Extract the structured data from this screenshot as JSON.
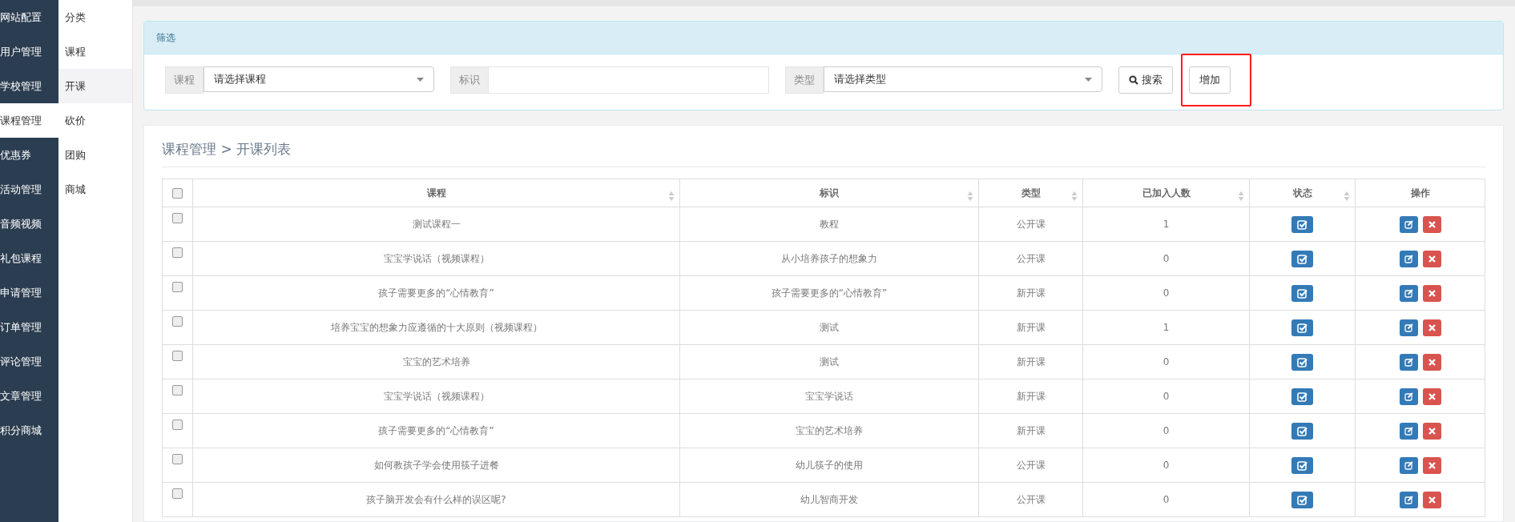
{
  "sidebar": {
    "items": [
      {
        "label": "网站配置",
        "selected": false
      },
      {
        "label": "用户管理",
        "selected": false
      },
      {
        "label": "学校管理",
        "selected": false
      },
      {
        "label": "课程管理",
        "selected": true
      },
      {
        "label": "优惠券",
        "selected": false
      },
      {
        "label": "活动管理",
        "selected": false
      },
      {
        "label": "音频视频",
        "selected": false
      },
      {
        "label": "礼包课程",
        "selected": false
      },
      {
        "label": "申请管理",
        "selected": false
      },
      {
        "label": "订单管理",
        "selected": false
      },
      {
        "label": "评论管理",
        "selected": false
      },
      {
        "label": "文章管理",
        "selected": false
      },
      {
        "label": "积分商城",
        "selected": false
      }
    ]
  },
  "submenu": {
    "items": [
      {
        "label": "分类",
        "selected": false
      },
      {
        "label": "课程",
        "selected": false
      },
      {
        "label": "开课",
        "selected": true
      },
      {
        "label": "砍价",
        "selected": false
      },
      {
        "label": "团购",
        "selected": false
      },
      {
        "label": "商城",
        "selected": false
      }
    ]
  },
  "filter": {
    "title": "筛选",
    "course": {
      "label": "课程",
      "value": "请选择课程"
    },
    "tag": {
      "label": "标识"
    },
    "type": {
      "label": "类型",
      "value": "请选择类型"
    },
    "search_button": "搜索",
    "add_button": {
      "label": "增加",
      "highlighted": true
    }
  },
  "list": {
    "breadcrumb": "课程管理 > 开课列表",
    "all_checked": false,
    "columns": [
      {
        "kind": "checkbox"
      },
      {
        "label": "课程",
        "kind": "text",
        "sortable": true
      },
      {
        "label": "标识",
        "kind": "text",
        "sortable": true
      },
      {
        "label": "类型",
        "kind": "text",
        "sortable": true
      },
      {
        "label": "已加入人数",
        "kind": "text",
        "sortable": true
      },
      {
        "label": "状态",
        "kind": "text",
        "sortable": true
      },
      {
        "label": "操作",
        "kind": "text",
        "sortable": false
      }
    ],
    "rows": [
      {
        "checked": false,
        "course": "测试课程一",
        "tag": "教程",
        "type": "公开课",
        "joined": "1"
      },
      {
        "checked": false,
        "course": "宝宝学说话（视频课程）",
        "tag": "从小培养孩子的想象力",
        "type": "公开课",
        "joined": "0"
      },
      {
        "checked": false,
        "course": "孩子需要更多的“心情教育”",
        "tag": "孩子需要更多的“心情教育”",
        "type": "新开课",
        "joined": "0"
      },
      {
        "checked": false,
        "course": "培养宝宝的想象力应遵循的十大原则（视频课程）",
        "tag": "测试",
        "type": "新开课",
        "joined": "1"
      },
      {
        "checked": false,
        "course": "宝宝的艺术培养",
        "tag": "测试",
        "type": "新开课",
        "joined": "0"
      },
      {
        "checked": false,
        "course": "宝宝学说话（视频课程）",
        "tag": "宝宝学说话",
        "type": "新开课",
        "joined": "0"
      },
      {
        "checked": false,
        "course": "孩子需要更多的“心情教育”",
        "tag": "宝宝的艺术培养",
        "type": "新开课",
        "joined": "0"
      },
      {
        "checked": false,
        "course": "如何教孩子学会使用筷子进餐",
        "tag": "幼儿筷子的使用",
        "type": "公开课",
        "joined": "0"
      },
      {
        "checked": false,
        "course": "孩子脑开发会有什么样的误区呢?",
        "tag": "幼儿智商开发",
        "type": "公开课",
        "joined": "0"
      }
    ]
  }
}
